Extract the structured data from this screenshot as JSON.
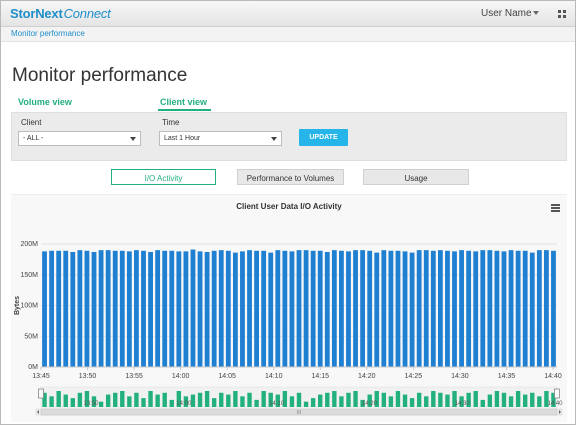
{
  "header": {
    "brand_primary": "StorNext",
    "brand_secondary": "Connect",
    "user_name": "User Name"
  },
  "breadcrumb": "Monitor performance",
  "page_title": "Monitor performance",
  "view_tabs": [
    {
      "label": "Volume view",
      "active": false
    },
    {
      "label": "Client view",
      "active": true
    }
  ],
  "filters": {
    "client_label": "Client",
    "client_value": "- ALL -",
    "time_label": "Time",
    "time_value": "Last 1 Hour",
    "update_label": "UPDATE"
  },
  "subtabs": [
    {
      "label": "I/O Activity",
      "active": true
    },
    {
      "label": "Performance to Volumes",
      "active": false
    },
    {
      "label": "Usage",
      "active": false
    }
  ],
  "colors": {
    "accent": "#23b07d",
    "link": "#1f8ec9",
    "bar": "#1f7fd1",
    "navigator_bar": "#22b07d",
    "button": "#25b5e8"
  },
  "chart_data": {
    "type": "bar",
    "title": "Client User Data I/O Activity",
    "ylabel": "Bytes",
    "xlabel": "",
    "yticks": [
      "0M",
      "50M",
      "100M",
      "150M",
      "200M"
    ],
    "ylim": [
      0,
      200
    ],
    "x_tick_labels": [
      "13:45",
      "13:50",
      "13:55",
      "14:00",
      "14:05",
      "14:10",
      "14:15",
      "14:20",
      "14:25",
      "14:30",
      "14:35",
      "14:40"
    ],
    "values": [
      188,
      189,
      189,
      189,
      187,
      190,
      189,
      187,
      190,
      190,
      189,
      189,
      188,
      190,
      189,
      187,
      190,
      189,
      189,
      188,
      188,
      191,
      188,
      187,
      189,
      190,
      189,
      186,
      188,
      190,
      189,
      189,
      186,
      190,
      189,
      188,
      190,
      190,
      189,
      189,
      187,
      190,
      189,
      188,
      190,
      190,
      189,
      186,
      190,
      189,
      189,
      188,
      186,
      190,
      190,
      189,
      190,
      189,
      188,
      190,
      189,
      188,
      190,
      190,
      189,
      188,
      190,
      189,
      189,
      186,
      190,
      190,
      189
    ],
    "navigator": {
      "values": [
        8,
        6,
        9,
        7,
        5,
        8,
        9,
        6,
        3,
        7,
        8,
        9,
        6,
        8,
        5,
        9,
        7,
        8,
        4,
        9,
        6,
        7,
        8,
        9,
        5,
        8,
        7,
        9,
        6,
        8,
        4,
        9,
        8,
        7,
        9,
        6,
        8,
        3,
        5,
        7,
        8,
        9,
        6,
        8,
        9,
        4,
        7,
        9,
        8,
        6,
        9,
        7,
        5,
        8,
        6,
        9,
        8,
        7,
        9,
        6,
        8,
        9,
        4,
        7,
        9,
        8,
        6,
        9,
        7,
        8,
        6,
        9,
        8
      ],
      "labels": [
        "13:50",
        "14:00",
        "14:10",
        "14:20",
        "14:30",
        "14:40"
      ],
      "scrollbar_label": "III"
    },
    "grid": true,
    "legend": "none"
  }
}
